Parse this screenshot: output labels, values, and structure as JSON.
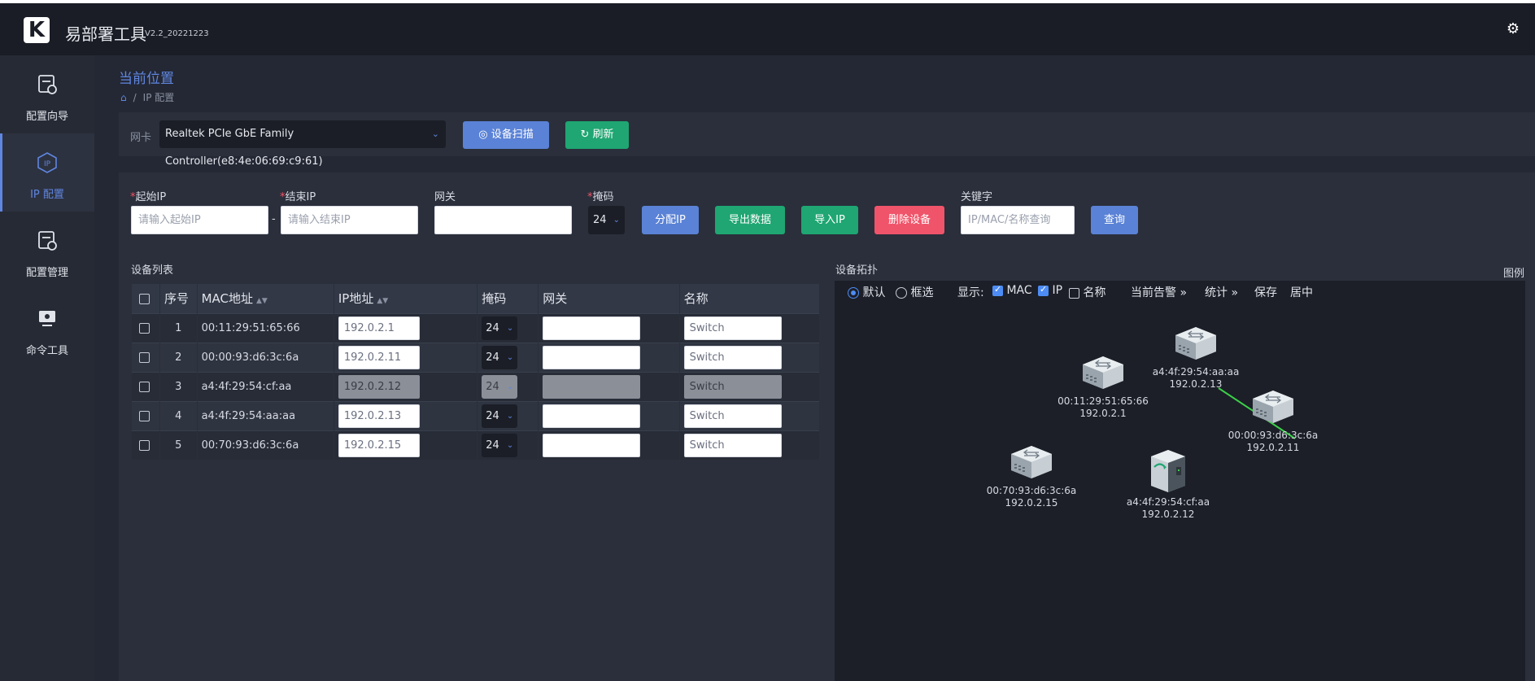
{
  "app": {
    "title": "易部署工具",
    "version": "V2.2_20221223",
    "logo_letter": "K"
  },
  "sidebar": {
    "items": [
      {
        "label": "配置向导",
        "icon": "config-wizard-icon",
        "active": false
      },
      {
        "label": "IP 配置",
        "icon": "ip-config-icon",
        "active": true
      },
      {
        "label": "配置管理",
        "icon": "config-manage-icon",
        "active": false
      },
      {
        "label": "命令工具",
        "icon": "command-tool-icon",
        "active": false
      }
    ]
  },
  "breadcrumb": {
    "title": "当前位置",
    "path": [
      "IP 配置"
    ]
  },
  "nic": {
    "label": "网卡",
    "selected": "Realtek PCIe GbE Family Controller(e8:4e:06:69:c9:61)",
    "scan_label": "设备扫描",
    "refresh_label": "刷新"
  },
  "form": {
    "start_ip": {
      "label": "起始IP",
      "placeholder": "请输入起始IP"
    },
    "dash": "-",
    "end_ip": {
      "label": "结束IP",
      "placeholder": "请输入结束IP"
    },
    "gateway": {
      "label": "网关",
      "placeholder": ""
    },
    "mask": {
      "label": "掩码",
      "value": "24"
    },
    "assign_label": "分配IP",
    "export_label": "导出数据",
    "import_label": "导入IP",
    "delete_label": "删除设备",
    "keyword": {
      "label": "关键字",
      "placeholder": "IP/MAC/名称查询"
    },
    "query_label": "查询"
  },
  "device_list": {
    "title": "设备列表",
    "columns": [
      "序号",
      "MAC地址",
      "IP地址",
      "掩码",
      "网关",
      "名称"
    ],
    "rows": [
      {
        "no": "1",
        "mac": "00:11:29:51:65:66",
        "ip": "192.0.2.1",
        "mask": "24",
        "gateway": "",
        "name": "Switch",
        "disabled": false
      },
      {
        "no": "2",
        "mac": "00:00:93:d6:3c:6a",
        "ip": "192.0.2.11",
        "mask": "24",
        "gateway": "",
        "name": "Switch",
        "disabled": false
      },
      {
        "no": "3",
        "mac": "a4:4f:29:54:cf:aa",
        "ip": "192.0.2.12",
        "mask": "24",
        "gateway": "",
        "name": "Switch",
        "disabled": true
      },
      {
        "no": "4",
        "mac": "a4:4f:29:54:aa:aa",
        "ip": "192.0.2.13",
        "mask": "24",
        "gateway": "",
        "name": "Switch",
        "disabled": false
      },
      {
        "no": "5",
        "mac": "00:70:93:d6:3c:6a",
        "ip": "192.0.2.15",
        "mask": "24",
        "gateway": "",
        "name": "Switch",
        "disabled": false
      }
    ]
  },
  "topology": {
    "title": "设备拓扑",
    "legend_label": "图例",
    "mode_default": "默认",
    "mode_select": "框选",
    "display_label": "显示:",
    "show_mac": {
      "label": "MAC",
      "checked": true
    },
    "show_ip": {
      "label": "IP",
      "checked": true
    },
    "show_name": {
      "label": "名称",
      "checked": false
    },
    "alarm_label": "当前告警",
    "stats_label": "统计",
    "save_label": "保存",
    "center_label": "居中",
    "link_color": "#3cd04a",
    "nodes": [
      {
        "mac": "a4:4f:29:54:aa:aa",
        "ip": "192.0.2.13",
        "kind": "switch"
      },
      {
        "mac": "00:11:29:51:65:66",
        "ip": "192.0.2.1",
        "kind": "switch"
      },
      {
        "mac": "00:00:93:d6:3c:6a",
        "ip": "192.0.2.11",
        "kind": "switch"
      },
      {
        "mac": "00:70:93:d6:3c:6a",
        "ip": "192.0.2.15",
        "kind": "switch"
      },
      {
        "mac": "a4:4f:29:54:cf:aa",
        "ip": "192.0.2.12",
        "kind": "server"
      }
    ]
  },
  "colors": {
    "accent": "#5f86e0",
    "primary_button": "#5a82d6",
    "success_button": "#1fa672",
    "danger_button": "#f0546a"
  }
}
